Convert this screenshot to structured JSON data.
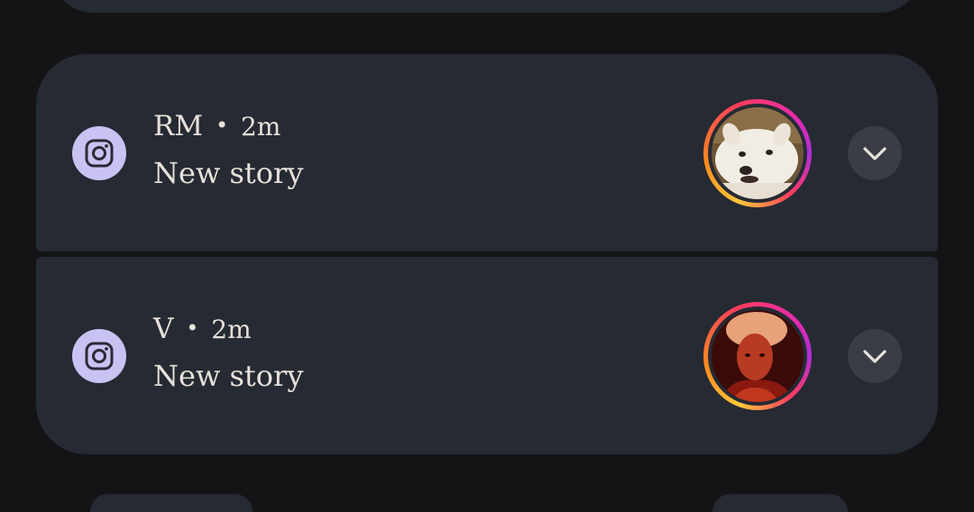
{
  "notifications": [
    {
      "app_icon": "instagram-icon",
      "sender": "RM",
      "separator": "•",
      "time": "2m",
      "message": "New story",
      "avatar": "dog-photo-avatar",
      "expand_icon": "chevron-down-icon"
    },
    {
      "app_icon": "instagram-icon",
      "sender": "V",
      "separator": "•",
      "time": "2m",
      "message": "New story",
      "avatar": "portrait-photo-avatar",
      "expand_icon": "chevron-down-icon"
    }
  ],
  "colors": {
    "background": "#141417",
    "card": "#262a33",
    "app_icon_bg": "#c9c3f4",
    "text": "#e6e1da",
    "expand_button_bg": "#3a3d46",
    "story_ring": [
      "#ffc83a",
      "#ff8a1e",
      "#ff3b5f",
      "#e32bb1",
      "#b02dd8"
    ]
  }
}
